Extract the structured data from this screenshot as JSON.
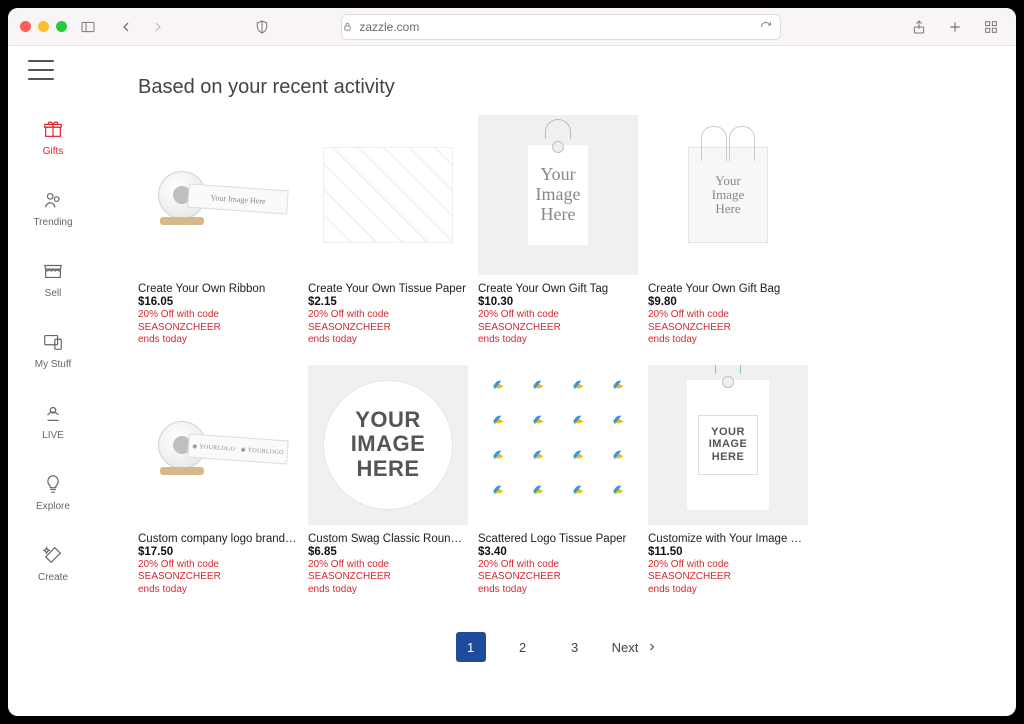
{
  "browser": {
    "url_host": "zazzle.com"
  },
  "sidebar": {
    "items": [
      {
        "label": "Gifts"
      },
      {
        "label": "Trending"
      },
      {
        "label": "Sell"
      },
      {
        "label": "My Stuff"
      },
      {
        "label": "LIVE"
      },
      {
        "label": "Explore"
      },
      {
        "label": "Create"
      }
    ]
  },
  "section_title": "Based on your recent activity",
  "products": [
    {
      "title": "Create Your Own Ribbon",
      "price": "$16.05",
      "promo_line1": "20% Off with code SEASONZCHEER",
      "promo_line2": "ends today",
      "thumb_text": "Your Image Here"
    },
    {
      "title": "Create Your Own Tissue Paper",
      "price": "$2.15",
      "promo_line1": "20% Off with code SEASONZCHEER",
      "promo_line2": "ends today",
      "thumb_text": ""
    },
    {
      "title": "Create Your Own Gift Tag",
      "price": "$10.30",
      "promo_line1": "20% Off with code SEASONZCHEER",
      "promo_line2": "ends today",
      "thumb_text": "Your\nImage\nHere"
    },
    {
      "title": "Create Your Own Gift Bag",
      "price": "$9.80",
      "promo_line1": "20% Off with code SEASONZCHEER",
      "promo_line2": "ends today",
      "thumb_text": "Your\nImage\nHere"
    },
    {
      "title": "Custom company logo branded business…",
      "price": "$17.50",
      "promo_line1": "20% Off with code SEASONZCHEER",
      "promo_line2": "ends today",
      "thumb_text": "YOURLOGO"
    },
    {
      "title": "Custom Swag Classic Round Sticker",
      "price": "$6.85",
      "promo_line1": "20% Off with code SEASONZCHEER",
      "promo_line2": "ends today",
      "thumb_text": "YOUR\nIMAGE\nHERE"
    },
    {
      "title": "Scattered Logo Tissue Paper",
      "price": "$3.40",
      "promo_line1": "20% Off with code SEASONZCHEER",
      "promo_line2": "ends today",
      "thumb_text": ""
    },
    {
      "title": "Customize with Your Image Gift Tags",
      "price": "$11.50",
      "promo_line1": "20% Off with code SEASONZCHEER",
      "promo_line2": "ends today",
      "thumb_text": "YOUR\nIMAGE\nHERE"
    }
  ],
  "pagination": {
    "pages": [
      "1",
      "2",
      "3"
    ],
    "next_label": "Next"
  }
}
